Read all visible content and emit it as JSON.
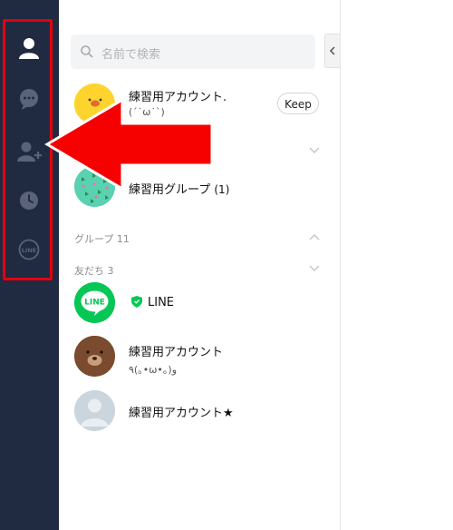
{
  "sidebar": {
    "items": [
      {
        "icon": "person-icon",
        "active": true
      },
      {
        "icon": "chat-bubble-icon",
        "active": false
      },
      {
        "icon": "add-friend-icon",
        "active": false
      },
      {
        "icon": "clock-icon",
        "active": false
      },
      {
        "icon": "line-logo-icon",
        "active": false,
        "label": "LINE"
      }
    ]
  },
  "search": {
    "placeholder": "名前で検索"
  },
  "profile": {
    "name": "練習用アカウント.",
    "status": "(ˊ˙ω˙ˋ)",
    "keep_label": "Keep"
  },
  "group_row": {
    "name": "練習用グループ",
    "count": "(1)"
  },
  "sections": {
    "groups": "グループ 11",
    "friends": "友だち 3"
  },
  "friends": [
    {
      "name": "LINE",
      "status": "",
      "badge": "official-shield-icon",
      "avatar_label": "LINE"
    },
    {
      "name": "練習用アカウント",
      "status": "٩(｡•ω•｡)و"
    },
    {
      "name": "練習用アカウント★",
      "status": ""
    }
  ],
  "colors": {
    "sidebar_bg": "#202a40",
    "highlight": "#e4000f",
    "line_green": "#06c755"
  }
}
